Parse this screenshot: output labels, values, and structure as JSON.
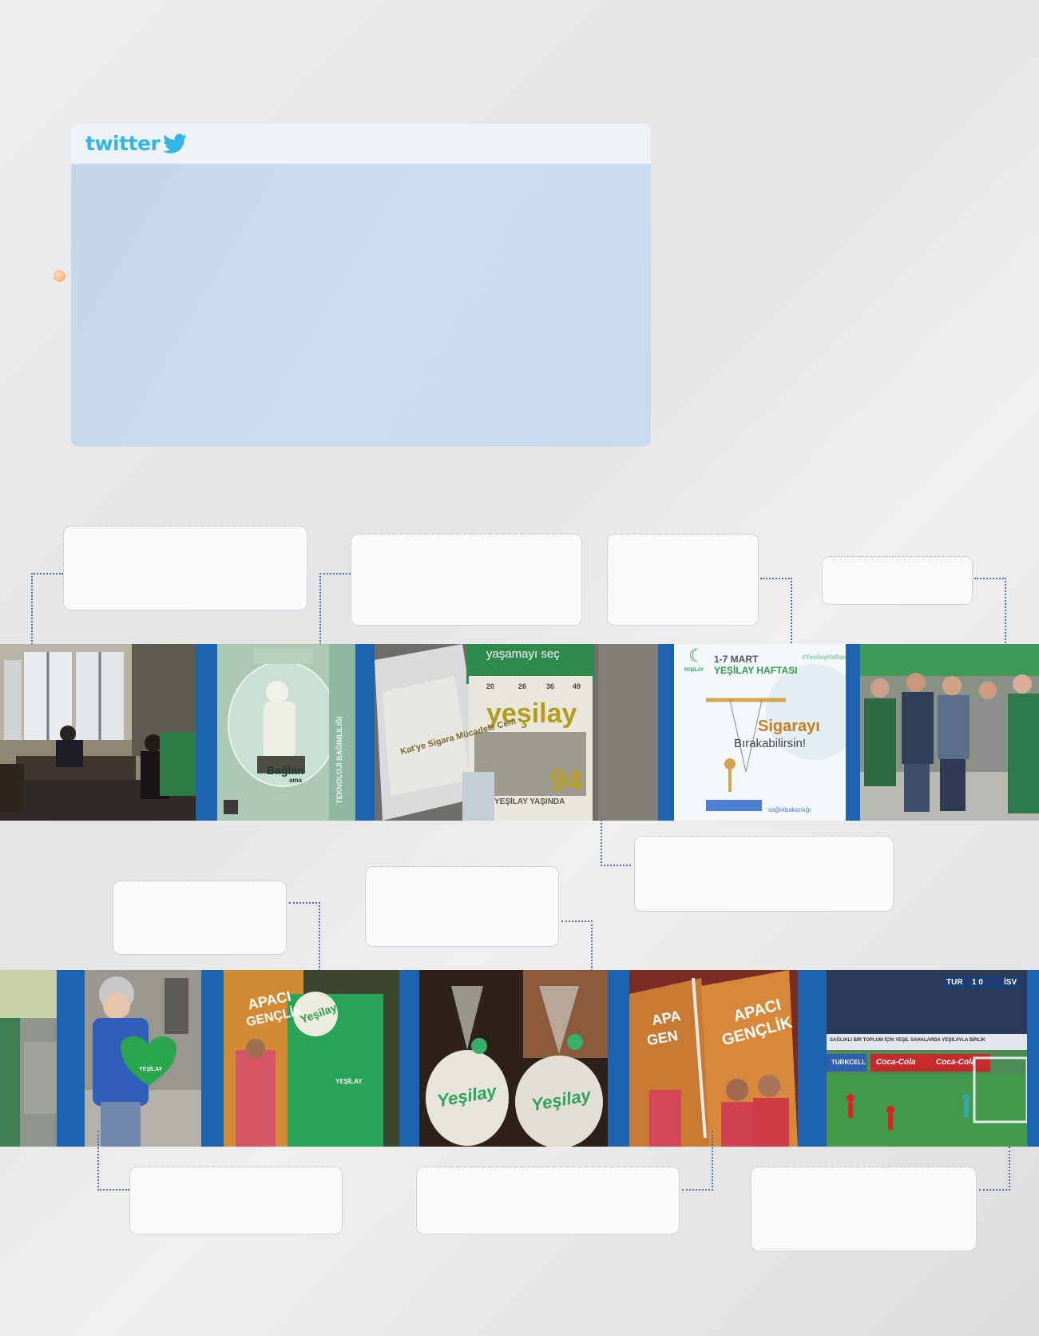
{
  "twitter": {
    "wordmark": "twitter",
    "logo_icon": "twitter-bird-icon",
    "brand_color": "#33b5e5"
  },
  "strip_color": "#1c64b0",
  "photos_row1": {
    "jar": {
      "line1": "Bağlan",
      "line2": "ama",
      "side": "TEKNOLOJİ BAĞIMLILIĞI"
    },
    "magazine": {
      "top": "yaşamayı seç",
      "brand": "yeşilay",
      "num1": "20",
      "num2": "26",
      "num3": "36",
      "num4": "49",
      "big": "94",
      "sub": "YEŞİLAY YAŞINDA",
      "brochure": "Kat'ye Sigara Mücadele Cem"
    },
    "poster": {
      "dates": "1-7 MART",
      "title": "YEŞİLAY HAFTASI",
      "hashtag": "#YesilayHaftasi",
      "headline1": "Sigarayı",
      "headline2": "Bırakabilirsin!",
      "footer": "sağlıkbakanlığı",
      "logo_text": "YEŞİLAY"
    }
  },
  "photos_row2": {
    "heart": {
      "text": "YEŞİLAY"
    },
    "book": {
      "title1": "APACI",
      "title2": "GENÇLİK",
      "notebook": "YEŞİLAY",
      "seal": "Yeşilay"
    },
    "cookies": {
      "left": "Yeşilay",
      "right": "Yeşilay"
    },
    "books": {
      "left1": "APA",
      "left2": "GEN",
      "right1": "APACI",
      "right2": "GENÇLİK"
    },
    "tv": {
      "score_home": "TUR",
      "score": "1  0",
      "score_away": "İSV",
      "banner": "SAĞLIKLI BİR TOPLUM İÇİN YEŞİL SAHALARDA YEŞİLAYLA BİRLİK",
      "ad1": "TURKCELL",
      "ad2": "Coca-Cola",
      "ad3": "Coca-Cola"
    }
  }
}
